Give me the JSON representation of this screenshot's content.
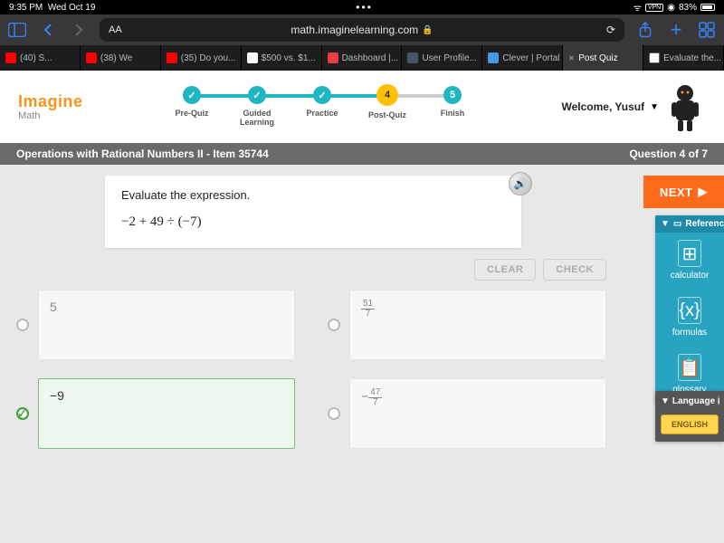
{
  "status": {
    "time": "9:35 PM",
    "date": "Wed Oct 19",
    "vpn": "VPN",
    "battery": "83%"
  },
  "browser": {
    "url": "math.imaginelearning.com",
    "aa": "AA",
    "tabs": [
      {
        "label": "(40) S..."
      },
      {
        "label": "(38) We"
      },
      {
        "label": "(35) Do you..."
      },
      {
        "label": "$500 vs. $1..."
      },
      {
        "label": "Dashboard |..."
      },
      {
        "label": "User Profile..."
      },
      {
        "label": "Clever | Portal"
      },
      {
        "label": "Post Quiz"
      },
      {
        "label": "Evaluate the..."
      }
    ]
  },
  "brand": {
    "top": "Imagine",
    "bottom": "Math"
  },
  "progress": {
    "steps": [
      {
        "label": "Pre-Quiz",
        "mark": "✓"
      },
      {
        "label": "Guided\nLearning",
        "mark": "✓"
      },
      {
        "label": "Practice",
        "mark": "✓"
      },
      {
        "label": "Post-Quiz",
        "mark": "4"
      },
      {
        "label": "Finish",
        "mark": "5"
      }
    ]
  },
  "welcome": "Welcome, Yusuf",
  "titlebar": {
    "left": "Operations with Rational Numbers II - Item 35744",
    "right": "Question 4 of 7"
  },
  "question": {
    "prompt": "Evaluate the expression.",
    "expression": "−2 + 49 ÷ (−7)"
  },
  "buttons": {
    "clear": "CLEAR",
    "check": "CHECK",
    "next": "NEXT"
  },
  "answers": {
    "a": "5",
    "b_num": "51",
    "b_den": "7",
    "c": "−9",
    "d_num": "47",
    "d_den": "7",
    "d_sign": "−"
  },
  "reference": {
    "header": "Reference",
    "calc": "calculator",
    "formulas": "formulas",
    "glossary": "glossary"
  },
  "language": {
    "header": "Language",
    "button": "ENGLISH"
  }
}
